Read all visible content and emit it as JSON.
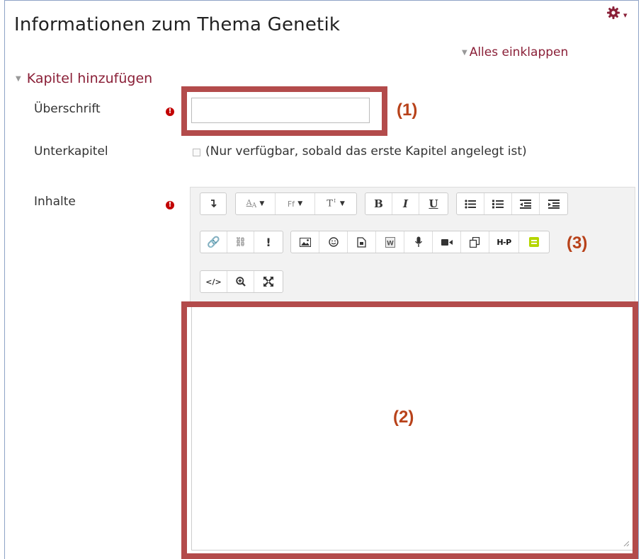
{
  "page": {
    "title": "Informationen zum Thema Genetik"
  },
  "menu": {
    "gear_icon": "gear-icon",
    "caret": "▾"
  },
  "form": {
    "collapse_all": "Alles einklappen",
    "section_title": "Kapitel hinzufügen",
    "heading_label": "Überschrift",
    "heading_value": "",
    "subchapter_label": "Unterkapitel",
    "subchapter_note": "(Nur verfügbar, sobald das erste Kapitel angelegt ist)",
    "content_label": "Inhalte",
    "required_icon": "!"
  },
  "editor": {
    "toolbar_rows": [
      [
        [
          "collapse-toolbar"
        ],
        [
          "font-color",
          "font-family",
          "font-size"
        ],
        [
          "bold",
          "italic",
          "underline"
        ],
        [
          "unordered-list",
          "ordered-list",
          "outdent",
          "indent"
        ]
      ],
      [
        [
          "link",
          "unlink",
          "no-autolink"
        ],
        [
          "image",
          "emoji",
          "media",
          "word-import",
          "record-audio",
          "record-video",
          "manage-files",
          "h5p",
          "generico"
        ]
      ],
      [
        [
          "html-source",
          "accessibility-checker",
          "fullscreen"
        ]
      ]
    ],
    "content": ""
  },
  "annotations": {
    "one": "(1)",
    "two": "(2)",
    "three": "(3)"
  },
  "colors": {
    "accent": "#8a1f37",
    "highlight_border": "#b34b4b",
    "marker_text": "#b8421a",
    "required": "#c20000"
  }
}
